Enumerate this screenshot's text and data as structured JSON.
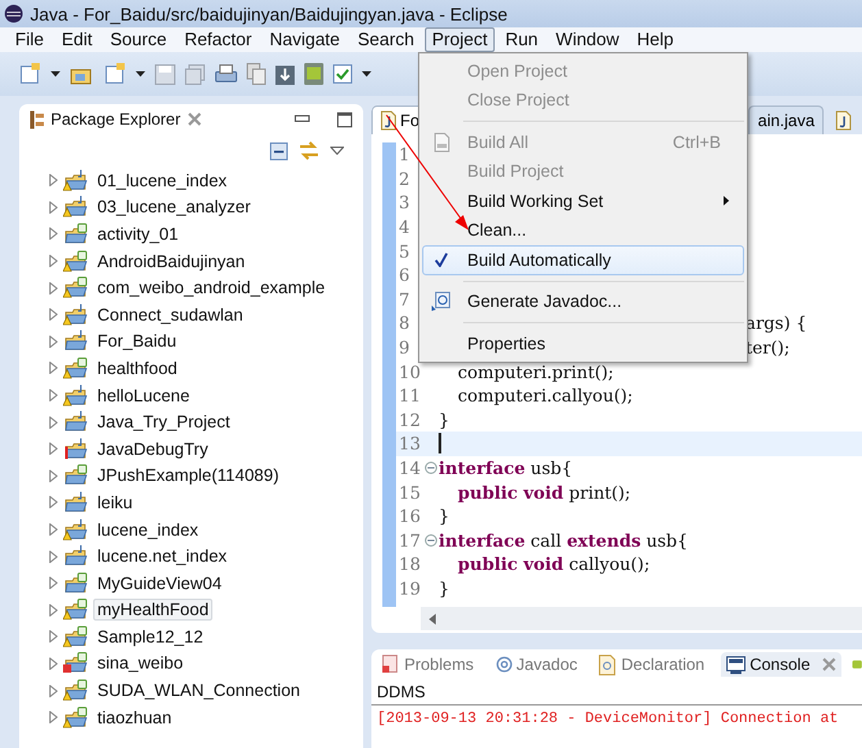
{
  "window": {
    "title": "Java - For_Baidu/src/baidujinyan/Baidujingyan.java - Eclipse"
  },
  "menu_bar": [
    {
      "label": "File",
      "selected": false
    },
    {
      "label": "Edit",
      "selected": false
    },
    {
      "label": "Source",
      "selected": false
    },
    {
      "label": "Refactor",
      "selected": false
    },
    {
      "label": "Navigate",
      "selected": false
    },
    {
      "label": "Search",
      "selected": false
    },
    {
      "label": "Project",
      "selected": true
    },
    {
      "label": "Run",
      "selected": false
    },
    {
      "label": "Window",
      "selected": false
    },
    {
      "label": "Help",
      "selected": false
    }
  ],
  "project_menu": [
    {
      "kind": "plain",
      "label": "Open Project",
      "disabled": true,
      "checked": false,
      "selected": false
    },
    {
      "kind": "plain",
      "label": "Close Project",
      "disabled": true,
      "checked": false,
      "selected": false
    },
    {
      "kind": "separator"
    },
    {
      "kind": "build",
      "label": "Build All",
      "shortcut": "Ctrl+B",
      "disabled": true,
      "checked": false,
      "selected": false
    },
    {
      "kind": "plain",
      "label": "Build Project",
      "disabled": true,
      "checked": false,
      "selected": false
    },
    {
      "kind": "plain",
      "label": "Build Working Set",
      "submenu": true,
      "disabled": false,
      "checked": false,
      "selected": false
    },
    {
      "kind": "plain",
      "label": "Clean...",
      "disabled": false,
      "checked": false,
      "selected": false
    },
    {
      "kind": "plain",
      "label": "Build Automatically",
      "disabled": false,
      "checked": true,
      "selected": true
    },
    {
      "kind": "separator"
    },
    {
      "kind": "javadoc",
      "label": "Generate Javadoc...",
      "disabled": false,
      "checked": false,
      "selected": false
    },
    {
      "kind": "separator"
    },
    {
      "kind": "plain",
      "label": "Properties",
      "disabled": false,
      "checked": false,
      "selected": false
    }
  ],
  "package_explorer": {
    "title": "Package Explorer",
    "items": [
      {
        "label": "01_lucene_index",
        "kind": "javawarning",
        "selected": false
      },
      {
        "label": "03_lucene_analyzer",
        "kind": "javawarning",
        "selected": false
      },
      {
        "label": "activity_01",
        "kind": "android",
        "selected": false
      },
      {
        "label": "AndroidBaidujinyan",
        "kind": "androidwarning",
        "selected": false
      },
      {
        "label": "com_weibo_android_example",
        "kind": "androidwarning",
        "selected": false
      },
      {
        "label": "Connect_sudawlan",
        "kind": "javawarning",
        "selected": false
      },
      {
        "label": "For_Baidu",
        "kind": "java",
        "selected": false
      },
      {
        "label": "healthfood",
        "kind": "androidwarning",
        "selected": false
      },
      {
        "label": "helloLucene",
        "kind": "javawarning",
        "selected": false
      },
      {
        "label": "Java_Try_Project",
        "kind": "java",
        "selected": false
      },
      {
        "label": "JavaDebugTry",
        "kind": "javaerror",
        "selected": false
      },
      {
        "label": "JPushExample(114089)",
        "kind": "android",
        "selected": false
      },
      {
        "label": "leiku",
        "kind": "java",
        "selected": false
      },
      {
        "label": "lucene_index",
        "kind": "javawarning",
        "selected": false
      },
      {
        "label": "lucene.net_index",
        "kind": "java",
        "selected": false
      },
      {
        "label": "MyGuideView04",
        "kind": "android",
        "selected": false
      },
      {
        "label": "myHealthFood",
        "kind": "androidwarning",
        "selected": true
      },
      {
        "label": "Sample12_12",
        "kind": "androidwarning",
        "selected": false
      },
      {
        "label": "sina_weibo",
        "kind": "androiderror",
        "selected": false
      },
      {
        "label": "SUDA_WLAN_Connection",
        "kind": "androidwarning",
        "selected": false
      },
      {
        "label": "tiaozhuan",
        "kind": "androidwarning",
        "selected": false
      }
    ]
  },
  "editor": {
    "tabs": [
      {
        "label": "Fo",
        "selected": true
      },
      {
        "label": "ain.java",
        "selected": false
      }
    ],
    "lines": [
      {
        "number": "1"
      },
      {
        "number": "2"
      },
      {
        "number": "3"
      },
      {
        "number": "4"
      },
      {
        "number": "5"
      },
      {
        "number": "6"
      },
      {
        "number": "7"
      },
      {
        "number": "8",
        "tail": true,
        "segments": [
          {
            "text": "args) {",
            "kind": "plain"
          }
        ]
      },
      {
        "number": "9",
        "tail": true,
        "segments": [
          {
            "text": "ter();",
            "kind": "plain"
          }
        ]
      },
      {
        "number": "10",
        "indented": true,
        "segments": [
          {
            "text": "computeri.print();",
            "kind": "plain"
          }
        ]
      },
      {
        "number": "11",
        "indented": true,
        "segments": [
          {
            "text": "computeri.callyou();",
            "kind": "plain"
          }
        ]
      },
      {
        "number": "12",
        "segments": [
          {
            "text": "}",
            "kind": "plain"
          }
        ]
      },
      {
        "number": "13",
        "current": true
      },
      {
        "number": "14",
        "foldable": true,
        "segments": [
          {
            "text": "interface",
            "kind": "keyword"
          },
          {
            "text": " usb{",
            "kind": "plain"
          }
        ]
      },
      {
        "number": "15",
        "indented": true,
        "segments": [
          {
            "text": "public void",
            "kind": "keyword"
          },
          {
            "text": " print();",
            "kind": "plain"
          }
        ]
      },
      {
        "number": "16",
        "segments": [
          {
            "text": "}",
            "kind": "plain"
          }
        ]
      },
      {
        "number": "17",
        "foldable": true,
        "segments": [
          {
            "text": "interface",
            "kind": "keyword"
          },
          {
            "text": " call ",
            "kind": "plain"
          },
          {
            "text": "extends",
            "kind": "keyword"
          },
          {
            "text": " usb{",
            "kind": "plain"
          }
        ]
      },
      {
        "number": "18",
        "indented": true,
        "segments": [
          {
            "text": "public void",
            "kind": "keyword"
          },
          {
            "text": " callyou();",
            "kind": "plain"
          }
        ]
      },
      {
        "number": "19",
        "segments": [
          {
            "text": "}",
            "kind": "plain"
          }
        ]
      }
    ]
  },
  "bottom_panel": {
    "tabs": [
      {
        "label": "Problems",
        "kind": "problems",
        "selected": false
      },
      {
        "label": "Javadoc",
        "kind": "javadoc",
        "selected": false
      },
      {
        "label": "Declaration",
        "kind": "declaration",
        "selected": false
      },
      {
        "label": "Console",
        "kind": "console",
        "selected": true
      }
    ],
    "console_title": "DDMS",
    "console_lines": [
      "[2013-09-13 20:31:28 - DeviceMonitor] Connection at"
    ]
  }
}
